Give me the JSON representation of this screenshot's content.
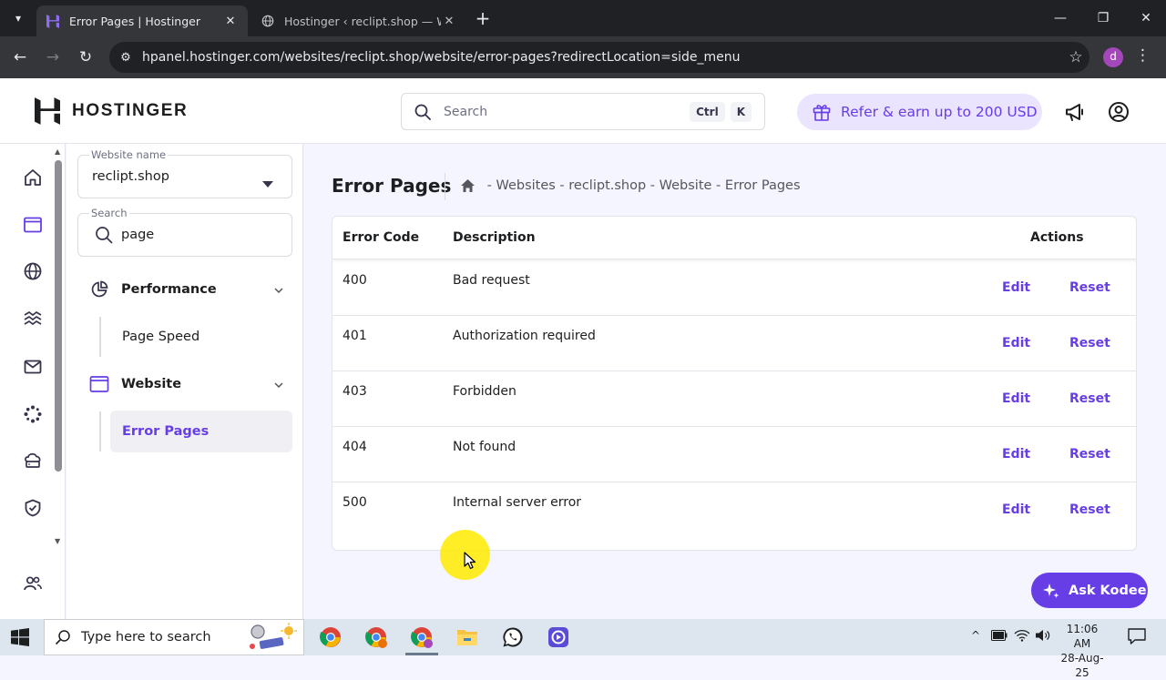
{
  "browser": {
    "tabs": [
      {
        "title": "Error Pages | Hostinger",
        "active": true
      },
      {
        "title": "Hostinger ‹ reclipt.shop — Wor",
        "active": false
      }
    ],
    "url": "hpanel.hostinger.com/websites/reclipt.shop/website/error-pages?redirectLocation=side_menu",
    "profile_initial": "d"
  },
  "header": {
    "brand": "HOSTINGER",
    "search_placeholder": "Search",
    "shortcut_keys": [
      "Ctrl",
      "K"
    ],
    "refer_label": "Refer & earn up to 200 USD"
  },
  "sidemenu": {
    "website_name_label": "Website name",
    "website_name_value": "reclipt.shop",
    "search_label": "Search",
    "search_value": "page",
    "groups": [
      {
        "label": "Performance",
        "items": [
          "Page Speed"
        ]
      },
      {
        "label": "Website",
        "items": [
          "Error Pages"
        ]
      }
    ]
  },
  "main": {
    "title": "Error Pages",
    "breadcrumb": [
      "Websites",
      "reclipt.shop",
      "Website",
      "Error Pages"
    ],
    "breadcrumb_separator": " - ",
    "columns": {
      "code": "Error Code",
      "description": "Description",
      "actions": "Actions"
    },
    "rows": [
      {
        "code": "400",
        "description": "Bad request"
      },
      {
        "code": "401",
        "description": "Authorization required"
      },
      {
        "code": "403",
        "description": "Forbidden"
      },
      {
        "code": "404",
        "description": "Not found"
      },
      {
        "code": "500",
        "description": "Internal server error"
      }
    ],
    "edit_label": "Edit",
    "reset_label": "Reset",
    "ask_kodee_label": "Ask Kodee"
  },
  "taskbar": {
    "search_placeholder": "Type here to search",
    "time": "11:06 AM",
    "date": "28-Aug-25"
  },
  "colors": {
    "accent": "#673de6",
    "accent_light": "#ebe4ff",
    "page_bg": "#f4f5ff"
  }
}
